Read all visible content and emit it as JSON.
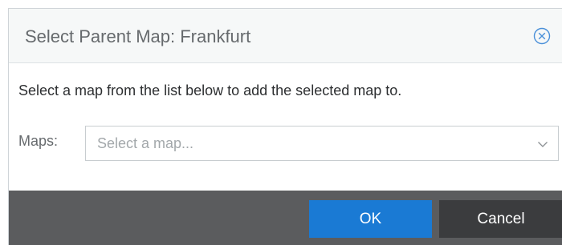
{
  "dialog": {
    "title": "Select Parent Map: Frankfurt",
    "instruction": "Select a map from the list below to add the selected map to.",
    "maps_label": "Maps:",
    "maps_select": {
      "placeholder": "Select a map..."
    },
    "ok_label": "OK",
    "cancel_label": "Cancel"
  },
  "icons": {
    "close": "close-circle-icon",
    "dropdown": "chevron-down-icon"
  },
  "colors": {
    "primary": "#1a7ad4",
    "footer_bg": "#5b5c5e",
    "cancel_bg": "#3b3c3e",
    "close_icon": "#4a90d9"
  }
}
